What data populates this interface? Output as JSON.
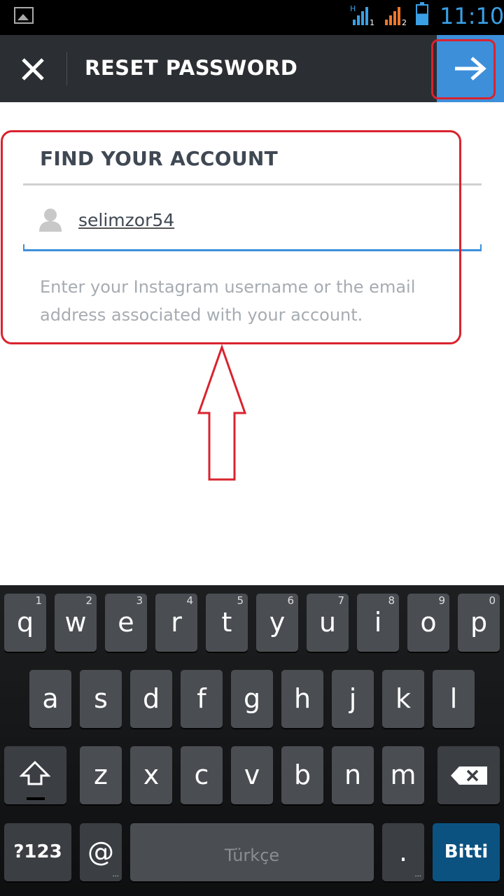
{
  "status_bar": {
    "time": "11:10",
    "network_1": "H",
    "sim_1": "1",
    "sim_2": "2"
  },
  "action_bar": {
    "title": "RESET PASSWORD"
  },
  "find_account": {
    "title": "FIND YOUR ACCOUNT",
    "username_value": "selimzor54",
    "helper_text": "Enter your Instagram username or the email address associated with your account."
  },
  "keyboard": {
    "row1": [
      {
        "label": "q",
        "num": "1"
      },
      {
        "label": "w",
        "num": "2"
      },
      {
        "label": "e",
        "num": "3"
      },
      {
        "label": "r",
        "num": "4"
      },
      {
        "label": "t",
        "num": "5"
      },
      {
        "label": "y",
        "num": "6"
      },
      {
        "label": "u",
        "num": "7"
      },
      {
        "label": "i",
        "num": "8"
      },
      {
        "label": "o",
        "num": "9"
      },
      {
        "label": "p",
        "num": "0"
      }
    ],
    "row2": [
      "a",
      "s",
      "d",
      "f",
      "g",
      "h",
      "j",
      "k",
      "l"
    ],
    "row3": [
      "z",
      "x",
      "c",
      "v",
      "b",
      "n",
      "m"
    ],
    "symbols_label": "?123",
    "at_label": "@",
    "space_label": "Türkçe",
    "period_label": ".",
    "done_label": "Bitti"
  },
  "colors": {
    "accent": "#3d8fd9",
    "annotation": "#d9232f",
    "action_bar": "#2b2f33"
  }
}
